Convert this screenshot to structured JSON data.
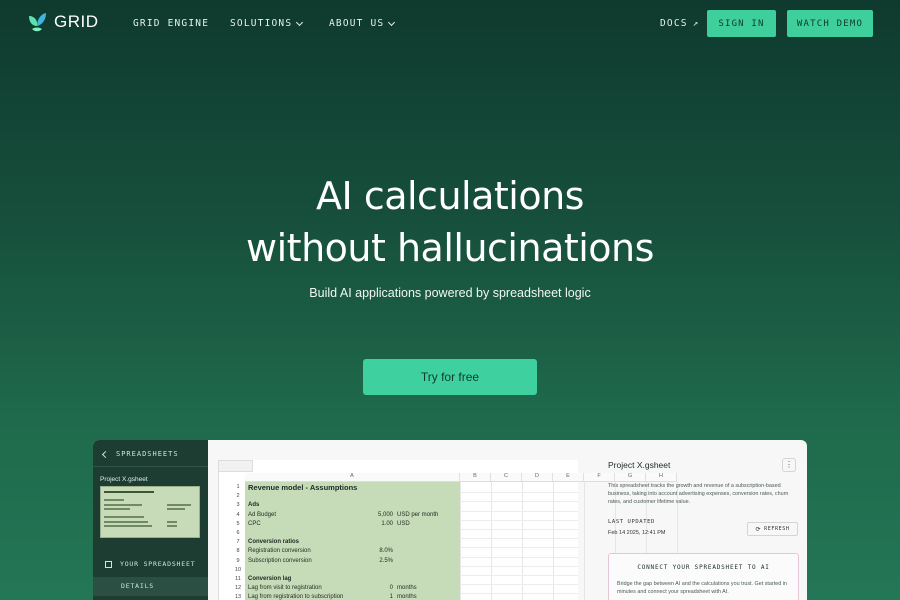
{
  "nav": {
    "logo_text": "GRID",
    "links": [
      "GRID ENGINE",
      "SOLUTIONS",
      "ABOUT US"
    ],
    "docs_label": "DOCS",
    "sign_in_label": "SIGN IN",
    "watch_demo_label": "WATCH DEMO"
  },
  "hero": {
    "title_line1": "AI calculations",
    "title_line2": "without hallucinations",
    "subtitle": "Build AI applications powered by spreadsheet logic",
    "cta_label": "Try for free"
  },
  "app": {
    "sidebar": {
      "header": "SPREADSHEETS",
      "project_name": "Project X.gsheet",
      "your_spreadsheet": "YOUR SPREADSHEET",
      "details": "DETAILS"
    },
    "sheet": {
      "columns": [
        "A",
        "B",
        "C",
        "D",
        "E",
        "F",
        "G",
        "H"
      ],
      "rows": [
        {
          "n": "1",
          "a": "Revenue model - Assumptions",
          "b": "",
          "c": "",
          "style": "big"
        },
        {
          "n": "2",
          "a": "",
          "b": "",
          "c": "",
          "style": ""
        },
        {
          "n": "3",
          "a": "Ads",
          "b": "",
          "c": "",
          "style": "b"
        },
        {
          "n": "4",
          "a": "Ad Budget",
          "b": "5,000",
          "c": "USD per month",
          "style": ""
        },
        {
          "n": "5",
          "a": "CPC",
          "b": "1.00",
          "c": "USD",
          "style": ""
        },
        {
          "n": "6",
          "a": "",
          "b": "",
          "c": "",
          "style": ""
        },
        {
          "n": "7",
          "a": "Conversion ratios",
          "b": "",
          "c": "",
          "style": "b"
        },
        {
          "n": "8",
          "a": "Registration conversion",
          "b": "8.0%",
          "c": "",
          "style": ""
        },
        {
          "n": "9",
          "a": "Subscription conversion",
          "b": "2.5%",
          "c": "",
          "style": ""
        },
        {
          "n": "10",
          "a": "",
          "b": "",
          "c": "",
          "style": ""
        },
        {
          "n": "11",
          "a": "Conversion lag",
          "b": "",
          "c": "",
          "style": "b"
        },
        {
          "n": "12",
          "a": "Lag from visit to registration",
          "b": "0",
          "c": "months",
          "style": ""
        },
        {
          "n": "13",
          "a": "Lag from registration to subscription",
          "b": "1",
          "c": "months",
          "style": ""
        }
      ]
    },
    "panel": {
      "title": "Project X.gsheet",
      "kebab": "⋮",
      "description": "This spreadsheet tracks the growth and revenue of a subscription-based business, taking into account advertising expenses, conversion rates, churn rates, and customer lifetime value.",
      "last_updated_label": "LAST UPDATED",
      "last_updated_value": "Feb 14 2025, 12:41 PM",
      "refresh_label": "REFRESH",
      "connect_title": "CONNECT YOUR SPREADSHEET TO AI",
      "connect_desc": "Bridge the gap between AI and the calculations you trust. Get started in minutes and connect your spreadsheet with AI."
    }
  },
  "colors": {
    "accent": "#3ecf9c",
    "bg_dark": "#0f3a2e",
    "bg_light": "#237656",
    "sheet_green": "#c6dbb7"
  }
}
